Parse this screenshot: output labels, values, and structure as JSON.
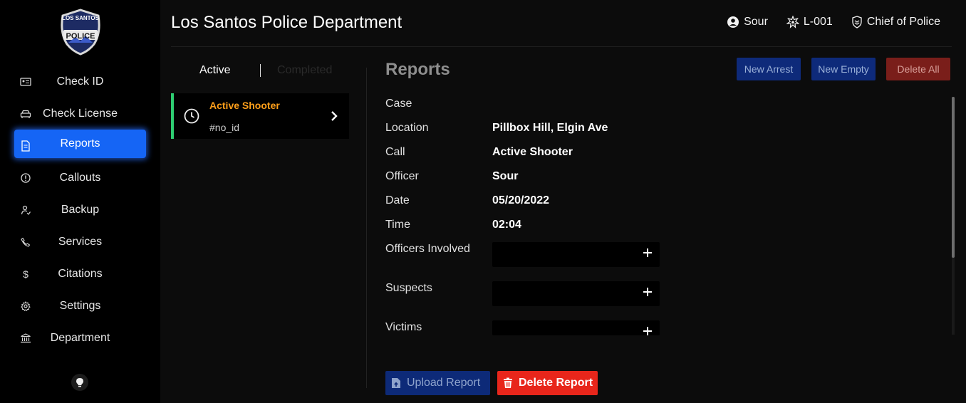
{
  "header": {
    "title": "Los Santos Police Department",
    "user_name": "Sour",
    "badge": "L-001",
    "rank": "Chief of Police"
  },
  "logo": {
    "top_text": "LOS SANTOS",
    "main_text": "POLICE"
  },
  "sidebar": {
    "items": [
      {
        "label": "Check ID",
        "icon": "id-card-icon"
      },
      {
        "label": "Check License",
        "icon": "car-icon"
      },
      {
        "label": "Reports",
        "icon": "document-icon",
        "active": true
      },
      {
        "label": "Callouts",
        "icon": "alert-circle-icon"
      },
      {
        "label": "Backup",
        "icon": "backup-icon"
      },
      {
        "label": "Services",
        "icon": "phone-icon"
      },
      {
        "label": "Citations",
        "icon": "dollar-icon"
      },
      {
        "label": "Settings",
        "icon": "gear-icon"
      },
      {
        "label": "Department",
        "icon": "building-icon"
      }
    ]
  },
  "list": {
    "tabs": {
      "active": "Active",
      "inactive": "Completed"
    },
    "items": [
      {
        "title": "Active Shooter",
        "id": "#no_id",
        "status_color": "#2ecc71",
        "title_color": "#ff9f1a"
      }
    ]
  },
  "report": {
    "title": "Reports",
    "buttons": {
      "new_arrest": "New Arrest",
      "new_empty": "New Empty",
      "delete_all": "Delete All"
    },
    "fields": {
      "case_label": "Case",
      "case_value": "",
      "location_label": "Location",
      "location_value": "Pillbox Hill, Elgin Ave",
      "call_label": "Call",
      "call_value": "Active Shooter",
      "officer_label": "Officer",
      "officer_value": "Sour",
      "date_label": "Date",
      "date_value": "05/20/2022",
      "time_label": "Time",
      "time_value": "02:04",
      "officers_involved_label": "Officers Involved",
      "suspects_label": "Suspects",
      "victims_label": "Victims"
    },
    "actions": {
      "upload": "Upload Report",
      "delete": "Delete Report"
    }
  },
  "colors": {
    "accent": "#1565f5",
    "active_status": "#2ecc71",
    "warning": "#ff9f1a",
    "danger": "#e8261b"
  }
}
